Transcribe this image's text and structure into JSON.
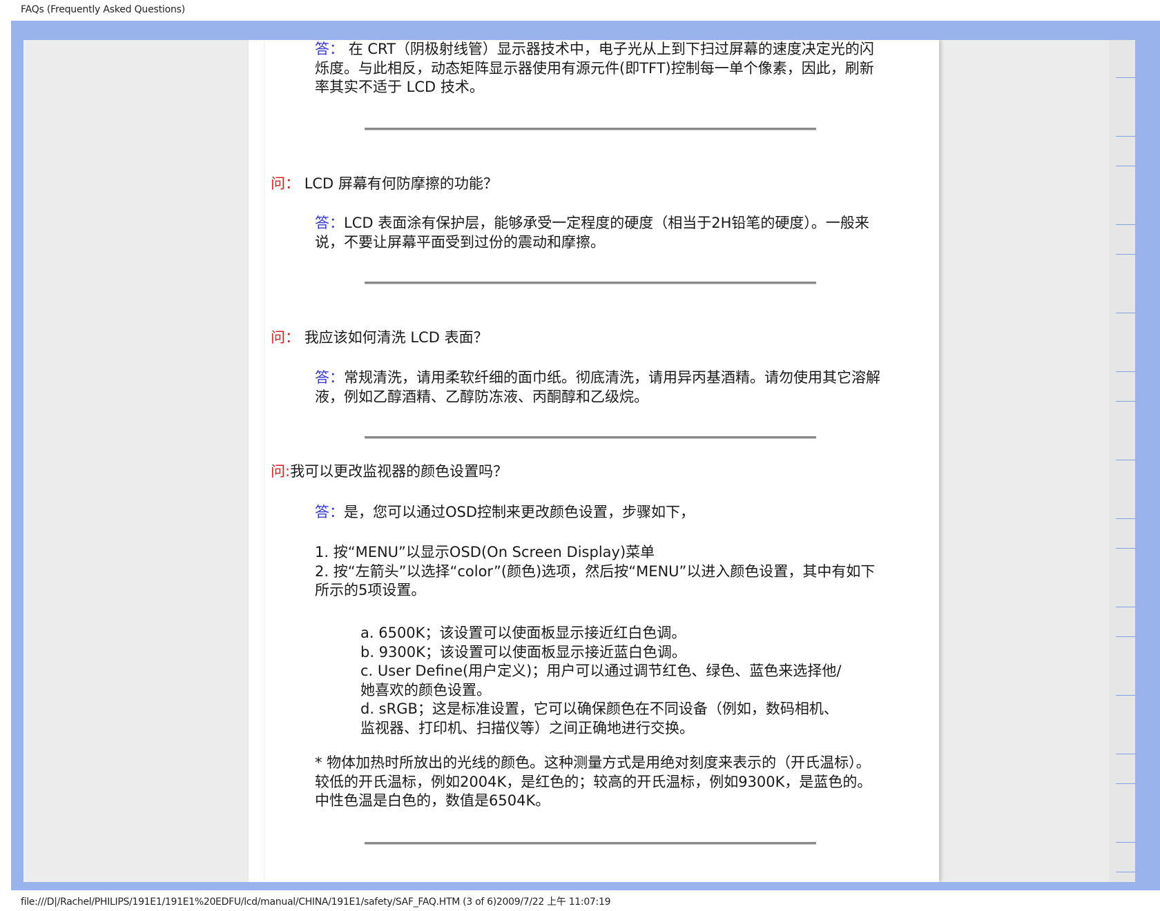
{
  "header": {
    "title": "FAQs (Frequently Asked Questions)"
  },
  "footer": {
    "path": "file:///D|/Rachel/PHILIPS/191E1/191E1%20EDFU/lcd/manual/CHINA/191E1/safety/SAF_FAQ.HTM (3 of 6)2009/7/22 上午 11:07:19"
  },
  "markers": {
    "question": "问：",
    "question_short": "问:",
    "answer": "答："
  },
  "faq": {
    "a0": "在 CRT（阴极射线管）显示器技术中，电子光从上到下扫过屏幕的速度决定光的闪烁度。与此相反，动态矩阵显示器使用有源元件(即TFT)控制每一单个像素，因此，刷新率其实不适于 LCD 技术。",
    "q1": "LCD 屏幕有何防摩擦的功能？",
    "a1": "LCD 表面涂有保护层，能够承受一定程度的硬度（相当于2H铅笔的硬度）。一般来说，不要让屏幕平面受到过份的震动和摩擦。",
    "q2": "我应该如何清洗 LCD 表面？",
    "a2": "常规清洗，请用柔软纤细的面巾纸。彻底清洗，请用异丙基酒精。请勿使用其它溶解液，例如乙醇酒精、乙醇防冻液、丙酮醇和乙级烷。",
    "q3": "我可以更改监视器的颜色设置吗？",
    "a3": "是，您可以通过OSD控制来更改颜色设置，步骤如下，",
    "steps": [
      "1. 按“MENU”以显示OSD(On Screen Display)菜单",
      "2. 按“左箭头”以选择“color”(颜色)选项，然后按“MENU”以进入颜色设置，其中有如下所示的5项设置。"
    ],
    "options": [
      "a. 6500K；该设置可以使面板显示接近红白色调。",
      "b. 9300K；该设置可以使面板显示接近蓝白色调。",
      "c. User Define(用户定义)；用户可以通过调节红色、绿色、蓝色来选择他/她喜欢的颜色设置。",
      "d. sRGB；这是标准设置，它可以确保颜色在不同设备（例如，数码相机、监视器、打印机、扫描仪等）之间正确地进行交换。"
    ],
    "note": "* 物体加热时所放出的光线的颜色。这种测量方式是用绝对刻度来表示的（开氏温标）。较低的开氏温标，例如2004K，是红色的；较高的开氏温标，例如9300K，是蓝色的。中性色温是白色的，数值是6504K。"
  },
  "colors": {
    "question_marker": "#e41b1b",
    "answer_marker": "#3a3ad8",
    "frame": "#99b4ec"
  }
}
